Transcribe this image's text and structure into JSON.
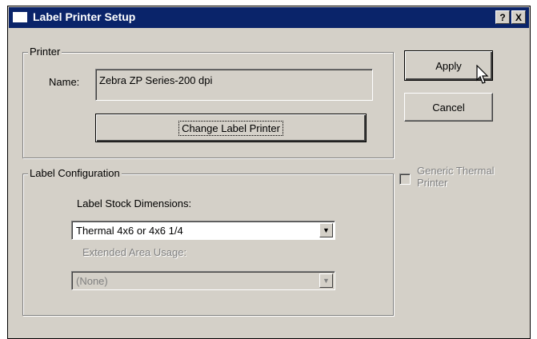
{
  "window": {
    "title": "Label Printer Setup",
    "help_glyph": "?",
    "close_glyph": "X"
  },
  "printer_group": {
    "title": "Printer",
    "name_label": "Name:",
    "name_value": "Zebra  ZP Series-200 dpi",
    "change_button": "Change Label Printer"
  },
  "label_config": {
    "title": "Label Configuration",
    "stock_label": "Label Stock Dimensions:",
    "stock_value": "Thermal 4x6 or 4x6 1/4",
    "extended_label": "Extended Area Usage:",
    "extended_value": "(None)"
  },
  "buttons": {
    "apply": "Apply",
    "cancel": "Cancel"
  },
  "generic_thermal": {
    "label_line1": "Generic Thermal",
    "label_line2": "Printer",
    "checked": false,
    "enabled": false
  },
  "icons": {
    "dropdown": "chevron-down-icon",
    "cursor": "mouse-pointer-icon"
  }
}
